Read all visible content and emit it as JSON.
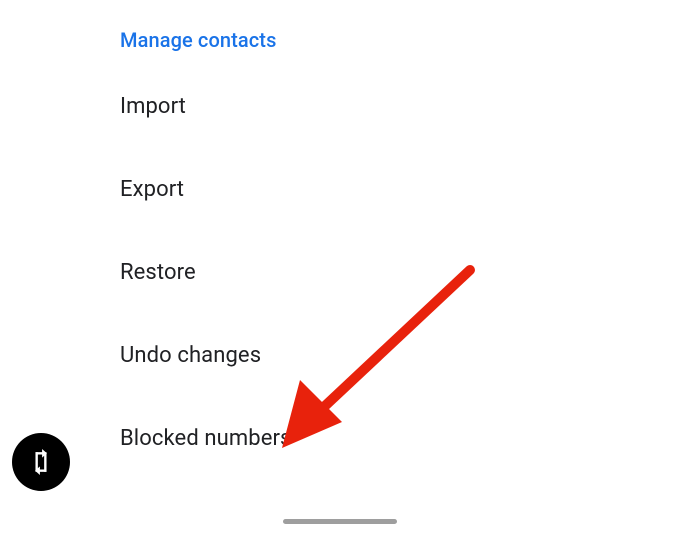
{
  "section": {
    "header": "Manage contacts",
    "items": [
      {
        "label": "Import"
      },
      {
        "label": "Export"
      },
      {
        "label": "Restore"
      },
      {
        "label": "Undo changes"
      },
      {
        "label": "Blocked numbers"
      }
    ]
  },
  "colors": {
    "accent": "#1a73e8",
    "text": "#202124",
    "fab_bg": "#000000",
    "annotation": "#e8220c"
  }
}
